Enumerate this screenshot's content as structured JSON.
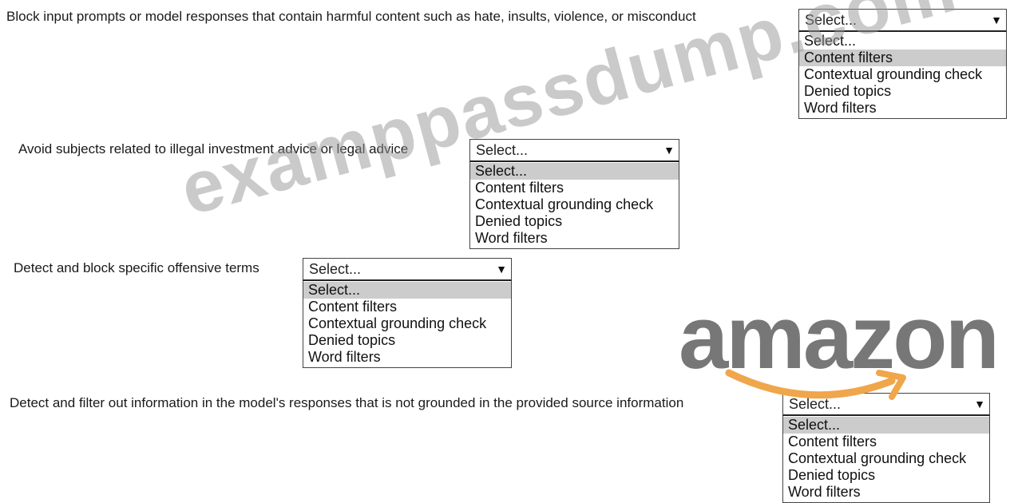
{
  "questions": [
    {
      "prompt": "Block input prompts or model responses that contain harmful content such as hate, insults, violence, or misconduct",
      "selected": "Select...",
      "highlighted_index": 1
    },
    {
      "prompt": "Avoid subjects related to illegal investment advice or legal advice",
      "selected": "Select...",
      "highlighted_index": 0
    },
    {
      "prompt": "Detect and block specific offensive terms",
      "selected": "Select...",
      "highlighted_index": 0
    },
    {
      "prompt": "Detect and filter out information in the model's responses that is not grounded in the provided source information",
      "selected": "Select...",
      "highlighted_index": 0
    }
  ],
  "options": [
    "Select...",
    "Content filters",
    "Contextual grounding check",
    "Denied topics",
    "Word filters"
  ],
  "caret_icon": "▼",
  "watermarks": {
    "site": "examppassdump.com",
    "brand": "amazon",
    "brand_smile_color": "#f0a64a"
  },
  "colors": {
    "highlight": "#cccccc",
    "border": "#444444"
  }
}
